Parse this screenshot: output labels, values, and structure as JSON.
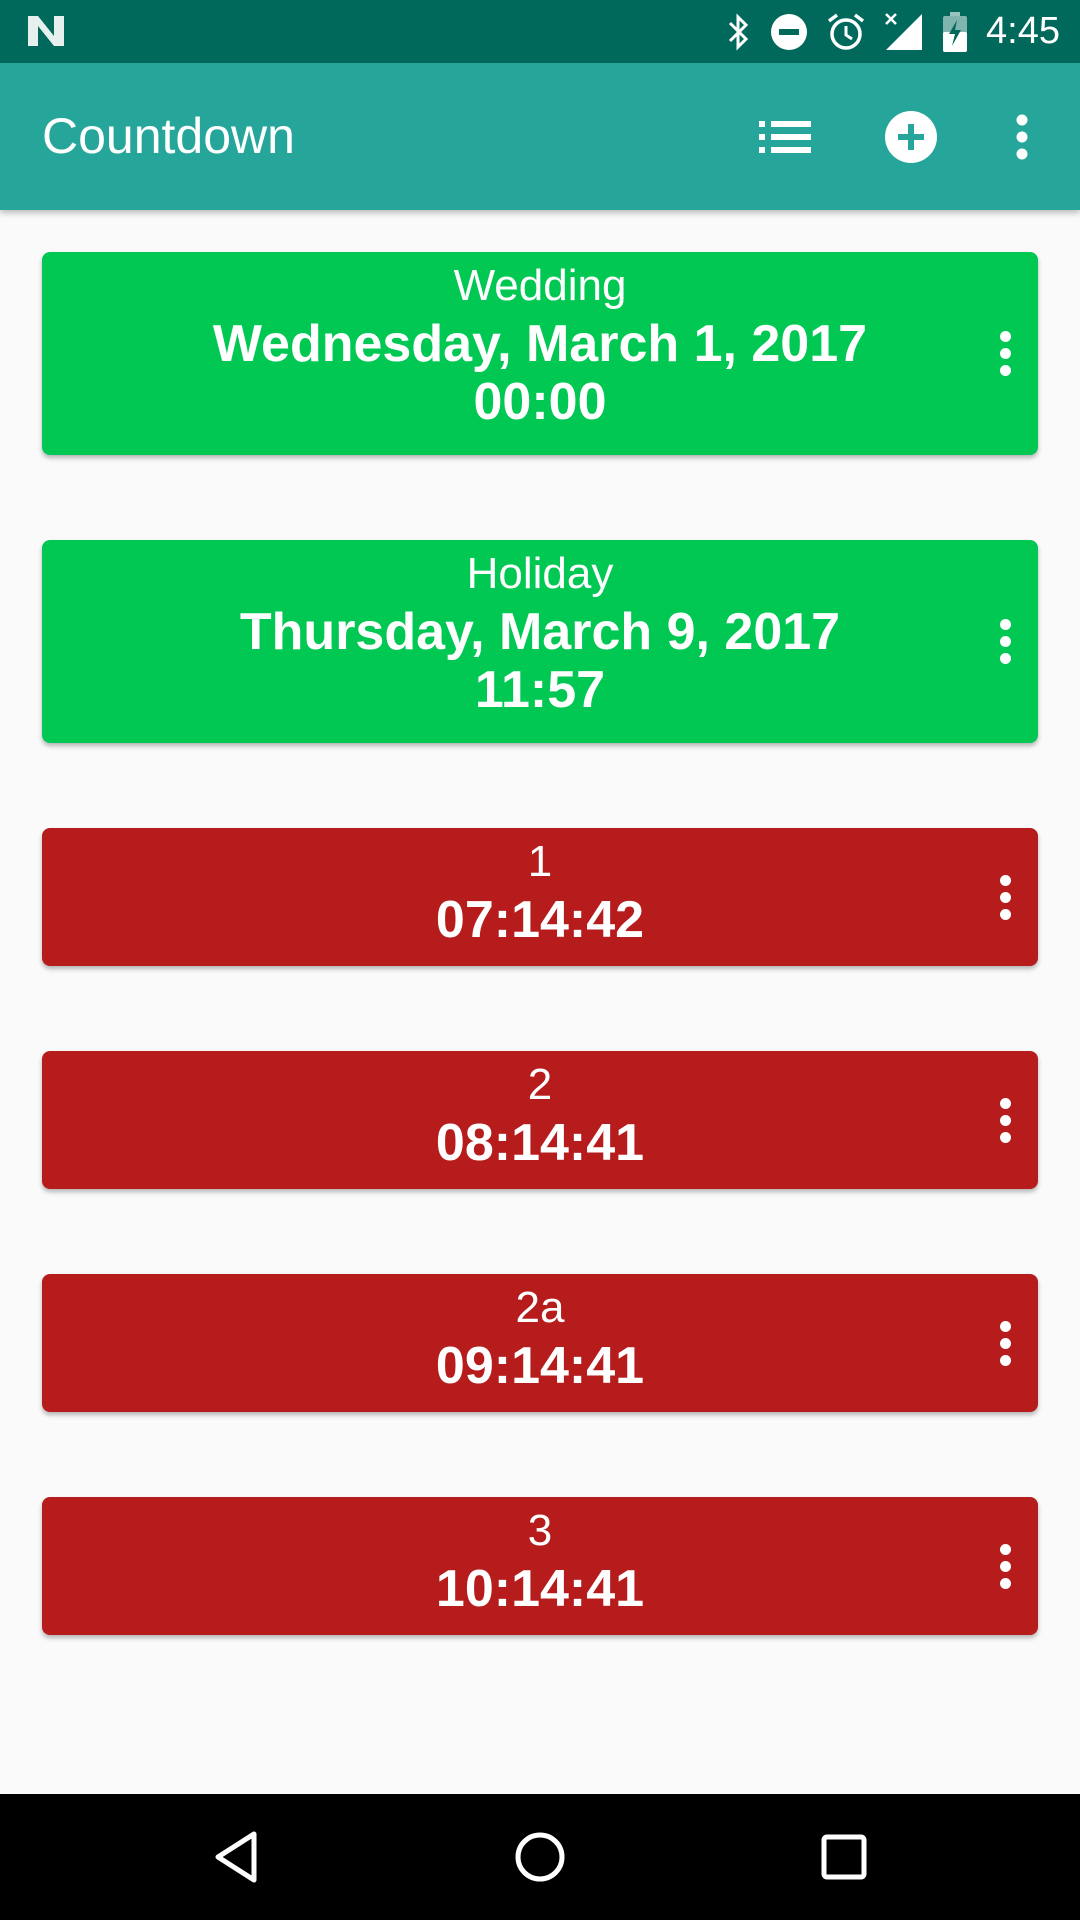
{
  "status_bar": {
    "time": "4:45",
    "icons": [
      "n-logo-icon",
      "bluetooth-icon",
      "do-not-disturb-icon",
      "alarm-icon",
      "signal-icon",
      "battery-charging-icon"
    ]
  },
  "app_bar": {
    "title": "Countdown",
    "actions": [
      "list-icon",
      "add-circle-icon",
      "more-vert-icon"
    ]
  },
  "items": [
    {
      "title": "Wedding",
      "lines": [
        "Wednesday, March 1, 2017",
        "00:00"
      ],
      "color": "#00c853"
    },
    {
      "title": "Holiday",
      "lines": [
        "Thursday, March 9, 2017",
        "11:57"
      ],
      "color": "#00c853"
    },
    {
      "title": "1",
      "lines": [
        "07:14:42"
      ],
      "color": "#b71c1c"
    },
    {
      "title": "2",
      "lines": [
        "08:14:41"
      ],
      "color": "#b71c1c"
    },
    {
      "title": "2a",
      "lines": [
        "09:14:41"
      ],
      "color": "#b71c1c"
    },
    {
      "title": "3",
      "lines": [
        "10:14:41"
      ],
      "color": "#b71c1c"
    }
  ],
  "colors": {
    "status_bar": "#00695c",
    "app_bar": "#26a69a",
    "future_event": "#00c853",
    "timer": "#b71c1c"
  },
  "nav_bar": {
    "icons": [
      "back-icon",
      "home-icon",
      "recents-icon"
    ]
  }
}
